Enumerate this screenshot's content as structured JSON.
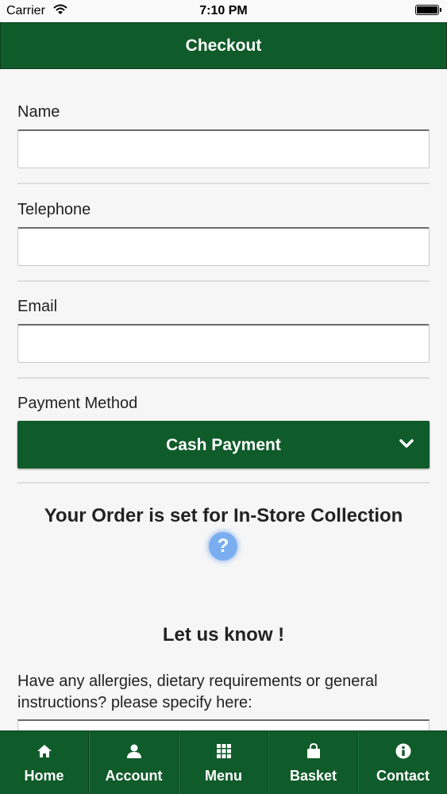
{
  "status_bar": {
    "carrier": "Carrier",
    "time": "7:10 PM"
  },
  "header": {
    "title": "Checkout"
  },
  "form": {
    "name_label": "Name",
    "name_value": "",
    "telephone_label": "Telephone",
    "telephone_value": "",
    "email_label": "Email",
    "email_value": "",
    "payment_label": "Payment Method",
    "payment_selected": "Cash Payment"
  },
  "collection_text": "Your Order is set for In-Store Collection",
  "help_icon": "?",
  "notes": {
    "heading": "Let us know !",
    "prompt": "Have any allergies, dietary requirements or general instructions? please specify here:"
  },
  "tabbar": {
    "items": [
      {
        "label": "Home",
        "icon": "home-icon"
      },
      {
        "label": "Account",
        "icon": "user-icon"
      },
      {
        "label": "Menu",
        "icon": "grid-icon"
      },
      {
        "label": "Basket",
        "icon": "bag-icon"
      },
      {
        "label": "Contact",
        "icon": "info-icon"
      }
    ]
  },
  "colors": {
    "brand": "#105b2a",
    "help": "#7aaef0",
    "background": "#f6f6f6"
  }
}
